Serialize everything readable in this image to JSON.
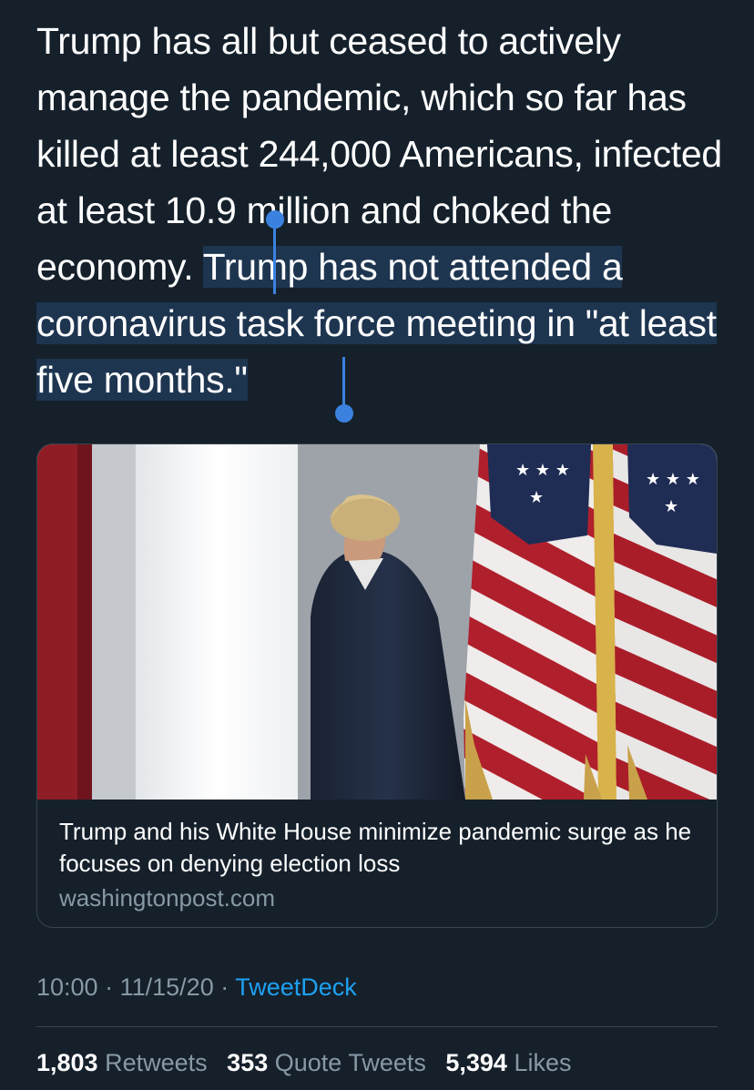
{
  "tweet": {
    "text_plain": "Trump has all but ceased to actively manage the pandemic, which so far has killed at least 244,000 Americans, infected at least 10.9 million and choked the economy. ",
    "text_selected": "Trump has not attended a coronavirus task force meeting in \"at least five months.\""
  },
  "card": {
    "image_alt": "Photo of Trump walking away past American flags",
    "title": "Trump and his White House minimize pandemic surge as he focuses on denying election loss",
    "domain": "washingtonpost.com"
  },
  "meta": {
    "time": "10:00",
    "date": "11/15/20",
    "separator": "·",
    "source": "TweetDeck"
  },
  "stats": {
    "retweets_count": "1,803",
    "retweets_label": "Retweets",
    "quotes_count": "353",
    "quotes_label": "Quote Tweets",
    "likes_count": "5,394",
    "likes_label": "Likes"
  },
  "colors": {
    "background": "#15202b",
    "selection": "#1e3550",
    "handle": "#3b82e0",
    "muted_text": "#8899a6",
    "link": "#1da1f2",
    "border": "#38444d"
  }
}
